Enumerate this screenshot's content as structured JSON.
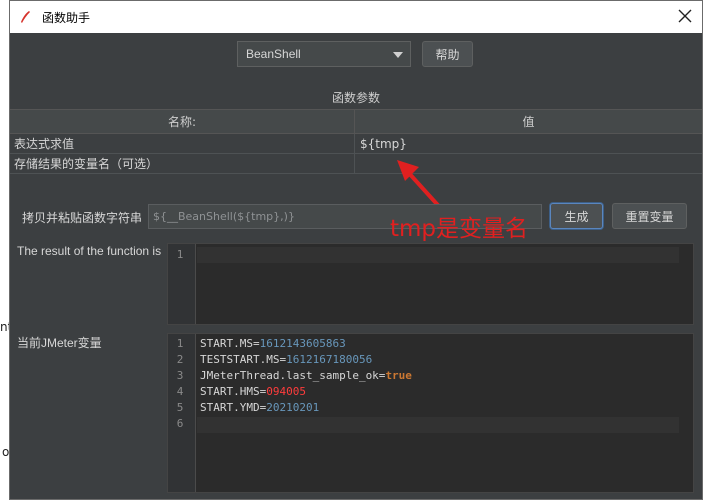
{
  "window": {
    "title": "函数助手",
    "function_select": "BeanShell",
    "help_label": "帮助"
  },
  "params": {
    "section_title": "函数参数",
    "col_name": "名称:",
    "col_value": "值",
    "rows": [
      {
        "name": "表达式求值",
        "value": "${tmp}"
      },
      {
        "name": "存储结果的变量名（可选）",
        "value": ""
      }
    ]
  },
  "copy": {
    "label": "拷贝并粘贴函数字符串",
    "value": "${__BeanShell(${tmp},)}",
    "generate_label": "生成",
    "reset_label": "重置变量"
  },
  "annotation": {
    "text": "tmp是变量名",
    "color": "#e02020"
  },
  "result": {
    "label": "The result of the function is",
    "line_numbers": [
      "1"
    ]
  },
  "vars": {
    "label": "当前JMeter变量",
    "line_numbers": [
      "1",
      "2",
      "3",
      "4",
      "5",
      "6"
    ],
    "lines": [
      {
        "key": "START.MS=",
        "val": "1612143605863"
      },
      {
        "key": "TESTSTART.MS=",
        "val": "1612167180056"
      },
      {
        "key": "JMeterThread.last_sample_ok=",
        "val": "true"
      },
      {
        "key": "START.HMS=",
        "val": "094005"
      },
      {
        "key": "START.YMD=",
        "val": "20210201"
      }
    ]
  },
  "background": {
    "frag1": "nt",
    "frag2": "o"
  },
  "colors": {
    "window_bg": "#3c3f41",
    "number": "#6897bb",
    "keyword": "#cc7832",
    "highlight_red": "#ff3c3c"
  }
}
